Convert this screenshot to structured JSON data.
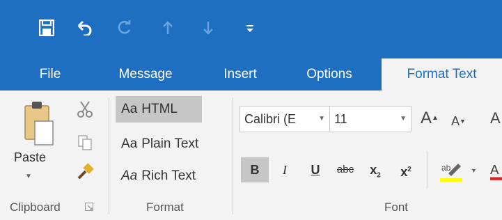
{
  "quick_access": {
    "items": [
      "save-icon",
      "undo-icon",
      "redo-icon",
      "up-arrow-icon",
      "down-arrow-icon",
      "customize-icon"
    ]
  },
  "tabs": [
    {
      "label": "File"
    },
    {
      "label": "Message"
    },
    {
      "label": "Insert"
    },
    {
      "label": "Options"
    },
    {
      "label": "Format Text",
      "active": true
    }
  ],
  "clipboard": {
    "paste_label": "Paste",
    "group_label": "Clipboard"
  },
  "format": {
    "group_label": "Format",
    "items": [
      {
        "prefix": "Aa",
        "label": "HTML",
        "selected": true
      },
      {
        "prefix": "Aa",
        "label": "Plain Text",
        "selected": false
      },
      {
        "prefix": "Aa",
        "label": "Rich Text",
        "selected": false
      }
    ]
  },
  "font": {
    "group_label": "Font",
    "font_name": "Calibri (E",
    "font_size": "11",
    "buttons": {
      "bold": "B",
      "italic": "I",
      "underline": "U",
      "strike": "abc",
      "subscript": "x",
      "superscript": "x"
    }
  },
  "colors": {
    "accent": "#1e6fc2",
    "highlight": "#ffff00",
    "font_color": "#e02020"
  }
}
